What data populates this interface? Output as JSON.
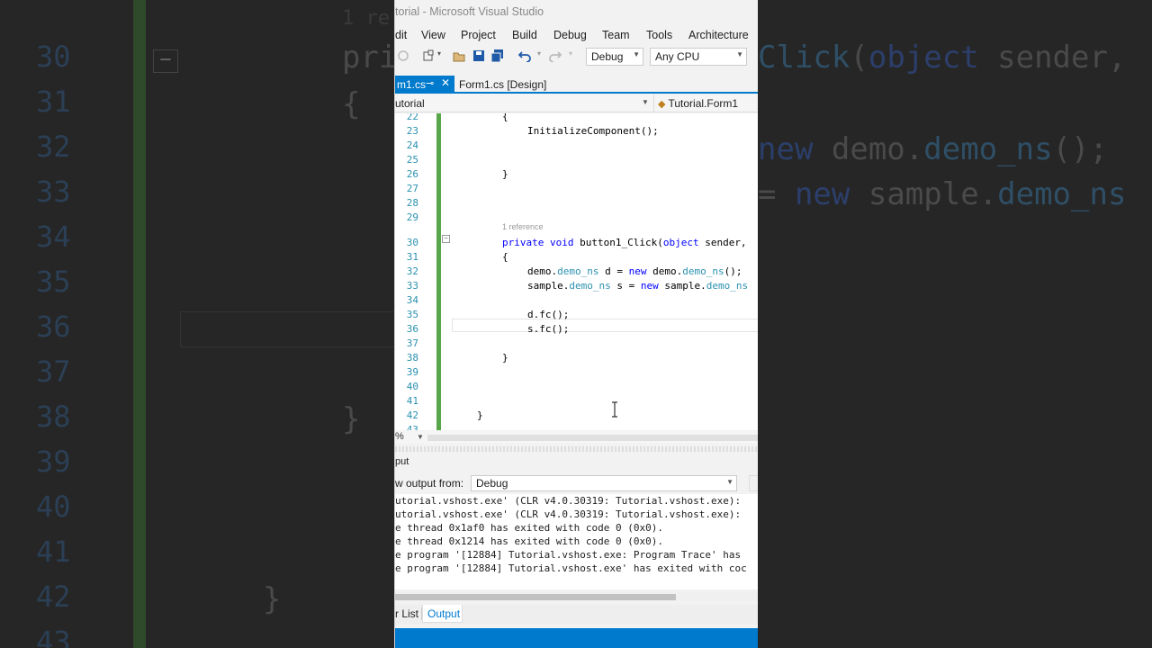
{
  "window": {
    "title": "torial - Microsoft Visual Studio",
    "menu": [
      "dit",
      "View",
      "Project",
      "Build",
      "Debug",
      "Team",
      "Tools",
      "Architecture"
    ]
  },
  "toolbar": {
    "config": "Debug",
    "platform": "Any CPU"
  },
  "tabs": {
    "active": "m1.cs",
    "second": "Form1.cs [Design]"
  },
  "navbar": {
    "left": "utorial",
    "right": "Tutorial.Form1"
  },
  "editor": {
    "reference_hint": "1 reference",
    "lines": [
      {
        "n": "22",
        "t": "{"
      },
      {
        "n": "23",
        "t": "InitializeComponent();"
      },
      {
        "n": "24",
        "t": ""
      },
      {
        "n": "25",
        "t": ""
      },
      {
        "n": "26",
        "t": "}"
      },
      {
        "n": "27",
        "t": ""
      },
      {
        "n": "28",
        "t": ""
      },
      {
        "n": "29",
        "t": ""
      },
      {
        "n": "30",
        "t": "private void button1_Click(object sender,"
      },
      {
        "n": "31",
        "t": "{"
      },
      {
        "n": "32",
        "t": "demo.demo_ns d = new demo.demo_ns();"
      },
      {
        "n": "33",
        "t": "sample.demo_ns s = new sample.demo_ns"
      },
      {
        "n": "34",
        "t": ""
      },
      {
        "n": "35",
        "t": "d.fc();"
      },
      {
        "n": "36",
        "t": "s.fc();"
      },
      {
        "n": "37",
        "t": ""
      },
      {
        "n": "38",
        "t": "}"
      },
      {
        "n": "39",
        "t": ""
      },
      {
        "n": "40",
        "t": ""
      },
      {
        "n": "41",
        "t": ""
      },
      {
        "n": "42",
        "t": "}"
      },
      {
        "n": "43",
        "t": ""
      }
    ]
  },
  "zoom": "%",
  "output": {
    "title": "put",
    "show_label": "w output from:",
    "source": "Debug",
    "lines": [
      "utorial.vshost.exe' (CLR v4.0.30319: Tutorial.vshost.exe):",
      "utorial.vshost.exe' (CLR v4.0.30319: Tutorial.vshost.exe):",
      "e thread 0x1af0 has exited with code 0 (0x0).",
      "e thread 0x1214 has exited with code 0 (0x0).",
      "e program '[12884] Tutorial.vshost.exe: Program Trace' has",
      "e program '[12884] Tutorial.vshost.exe' has exited with coc"
    ]
  },
  "bottom_tabs": {
    "error_list": "r List",
    "output": "Output"
  },
  "backdrop": {
    "ref": "1 re",
    "numbers": [
      "30",
      "31",
      "32",
      "33",
      "34",
      "35",
      "36",
      "37",
      "38",
      "39",
      "40",
      "41",
      "42",
      "43"
    ],
    "code": [
      {
        "row": "30",
        "text": "pri"
      },
      {
        "row": "31",
        "text": "{"
      },
      {
        "row": "38",
        "text": "}"
      },
      {
        "row": "42",
        "text": "}"
      }
    ],
    "right_code": [
      "Click(object sender,",
      "new demo.demo_ns();",
      "= new sample.demo_ns"
    ]
  },
  "colors": {
    "accent": "#007acc",
    "keyword": "#0000ff",
    "type": "#2b91af",
    "change_bar": "#57a64a"
  }
}
